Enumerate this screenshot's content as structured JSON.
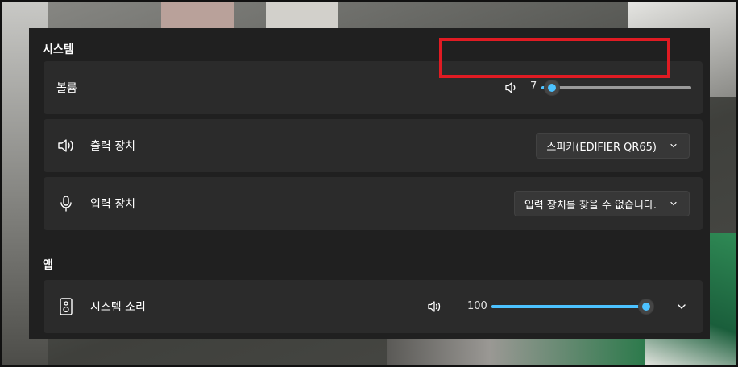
{
  "colors": {
    "accent": "#4cc2ff",
    "highlight": "#e01b23",
    "panel": "#202020",
    "card": "#2b2b2b"
  },
  "system": {
    "title": "시스템",
    "volume": {
      "label": "볼륨",
      "value": "7",
      "level": 0.07,
      "icon": "speaker-low-icon"
    },
    "output": {
      "label": "출력 장치",
      "selected": "스피커(EDIFIER QR65)",
      "icon": "speaker-icon"
    },
    "input": {
      "label": "입력 장치",
      "selected": "입력 장치를 찾을 수 없습니다.",
      "icon": "microphone-icon"
    }
  },
  "apps": {
    "title": "앱",
    "items": [
      {
        "label": "시스템 소리",
        "value": "100",
        "level": 1.0,
        "icon": "system-sounds-icon"
      }
    ]
  }
}
